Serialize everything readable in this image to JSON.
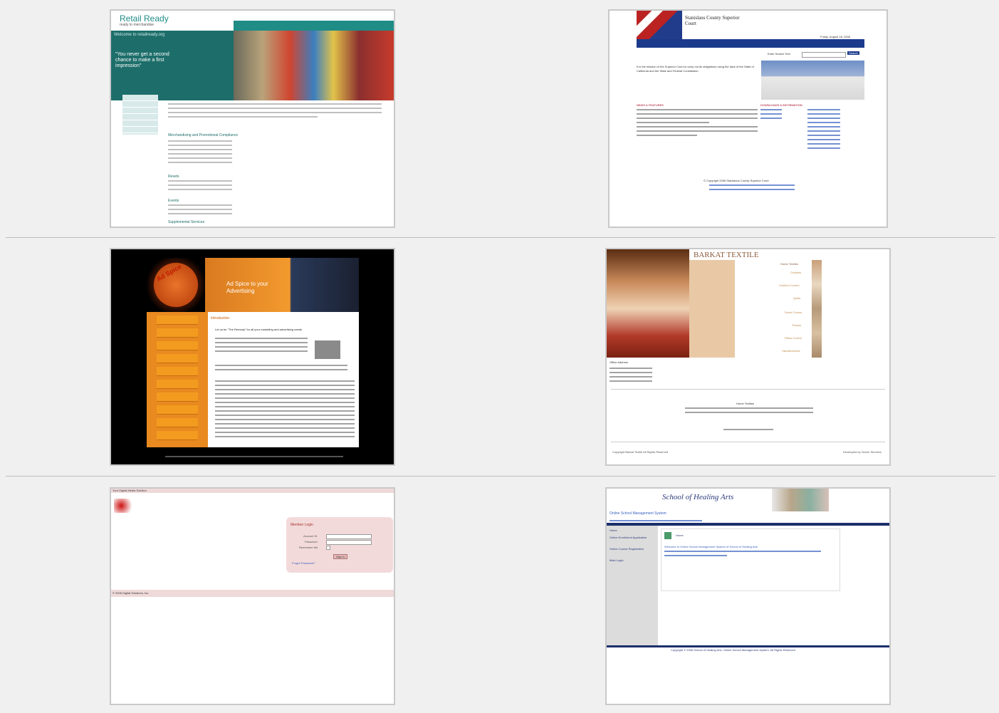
{
  "thumbnails": [
    {
      "id": "retail-ready",
      "title": "Retail Ready",
      "subtitle": "ready to merchandise",
      "welcome": "Welcome to retailready.org",
      "tagline": "\"You never get a second chance to make a first impression\"",
      "nav": [
        "Home",
        "About RR",
        "Services",
        "Request Info",
        "Job Opportunities",
        "Client Login"
      ],
      "sections": [
        "Merchandising",
        "Merchandising and Promotional Compliance",
        "Resets",
        "Events",
        "Supplemental Services"
      ]
    },
    {
      "id": "stanislaus-court",
      "title": "Stanislaus County Superior Court",
      "date": "Friday, August 18, 2006",
      "search_label": "Enter Search Text",
      "search_button": "Search",
      "mission": "It is the mission of the Superior Court to carry out its obligations using the laws of the State of California and the State and Federal Constitution.",
      "news_heading": "NEWS & FEATURES",
      "downloads_heading": "DOWNLOADS & INFORMATION",
      "copyright": "© Copyright 2006 Stanislaus County Superior Court"
    },
    {
      "id": "ad-spice",
      "logo": "Ad Spice",
      "banner_text": "Ad Spice to your Advertising",
      "menu": [
        "ABOUT US",
        "COMPANY PROFILE",
        "OUR WORK",
        "SERVICES",
        "PROMOTIONS",
        "OUR CUSTOMERS",
        "CAREERS",
        "PORTFOLIO",
        "SITEMAP",
        "CONTACT US"
      ],
      "heading": "Introduction",
      "lead": "Let us be \"The Remedy\" for all your marketing and advertising needs"
    },
    {
      "id": "barkat-textile",
      "title": "BARKAT TEXTILE",
      "categories": [
        "Home Textiles",
        "Curtains",
        "Cushion Covers",
        "Quilts",
        "Duvet Covers",
        "Throws",
        "Pillow Covers",
        "Handkerchiefs"
      ],
      "office_label": "Office Address",
      "footer_title": "Home Textiles",
      "copyright": "Copyright Barkat Textile All Rights Reserved",
      "credit": "Developed by Ozone Services"
    },
    {
      "id": "member-login",
      "top_left": "Your Digital Media Solution",
      "login_title": "Member Login",
      "fields": [
        "Account ID",
        "Password",
        "Remember Me"
      ],
      "sign_in": "Sign In",
      "forgot": "Forgot Password?",
      "copyright": "© 2006 Digital Solutions, Inc."
    },
    {
      "id": "school-of-healing-arts",
      "title": "School of Healing Arts",
      "subtitle": "Online School Management System",
      "nav": [
        "Home",
        "Online Enrollment Application",
        "Online Course Registration",
        "Main Login"
      ],
      "welcome": "Welcome to Online School Management System of School of Healing Arts",
      "footer": "Copyright © 2006 School of Healing Arts, Online School Management System. All Rights Reserved"
    }
  ]
}
